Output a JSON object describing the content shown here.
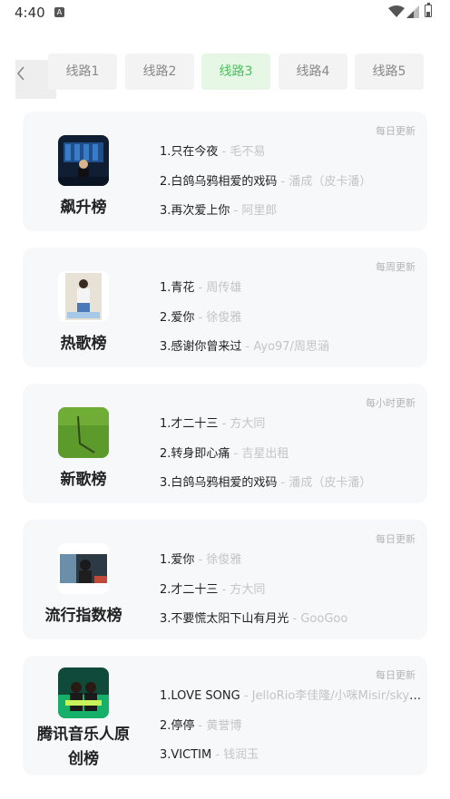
{
  "status_bar": {
    "time": "4:40",
    "app_icon": "A"
  },
  "icons": {
    "back": "chevron-left",
    "wifi": "wifi",
    "signal": "cellular-signal",
    "battery": "battery"
  },
  "colors": {
    "accent": "#4cbf5c",
    "accent_bg": "#e6f7e6",
    "card_bg": "#f7f8fa",
    "muted": "#c4c4c4"
  },
  "tabs": [
    {
      "label": "线路1",
      "active": false
    },
    {
      "label": "线路2",
      "active": false
    },
    {
      "label": "线路3",
      "active": true
    },
    {
      "label": "线路4",
      "active": false
    },
    {
      "label": "线路5",
      "active": false
    }
  ],
  "charts": [
    {
      "name": "飙升榜",
      "frequency": "每日更新",
      "songs": [
        {
          "title": "1.只在今夜",
          "artist": " - 毛不易"
        },
        {
          "title": "2.白鸽乌鸦相爱的戏码",
          "artist": " - 潘成（皮卡潘）"
        },
        {
          "title": "3.再次爱上你",
          "artist": " - 阿里郎"
        }
      ]
    },
    {
      "name": "热歌榜",
      "frequency": "每周更新",
      "songs": [
        {
          "title": "1.青花",
          "artist": " - 周传雄"
        },
        {
          "title": "2.爱你",
          "artist": " - 徐俊雅"
        },
        {
          "title": "3.感谢你曾来过",
          "artist": " - Ayo97/周思涵"
        }
      ]
    },
    {
      "name": "新歌榜",
      "frequency": "每小时更新",
      "songs": [
        {
          "title": "1.才二十三",
          "artist": " - 方大同"
        },
        {
          "title": "2.转身即心痛",
          "artist": " - 吉星出租"
        },
        {
          "title": "3.白鸽乌鸦相爱的戏码",
          "artist": " - 潘成（皮卡潘）"
        }
      ]
    },
    {
      "name": "流行指数榜",
      "frequency": "每日更新",
      "songs": [
        {
          "title": "1.爱你",
          "artist": " - 徐俊雅"
        },
        {
          "title": "2.才二十三",
          "artist": " - 方大同"
        },
        {
          "title": "3.不要慌太阳下山有月光",
          "artist": " - GooGoo"
        }
      ]
    },
    {
      "name": "腾讯音乐人原创榜",
      "frequency": "每日更新",
      "songs": [
        {
          "title": "1.LOVE SONG",
          "artist": " - JelloRio李佳隆/小咪Misir/skyslite"
        },
        {
          "title": "2.停停",
          "artist": " - 黄誉博"
        },
        {
          "title": "3.VICTIM",
          "artist": " - 钱润玉"
        }
      ]
    }
  ]
}
